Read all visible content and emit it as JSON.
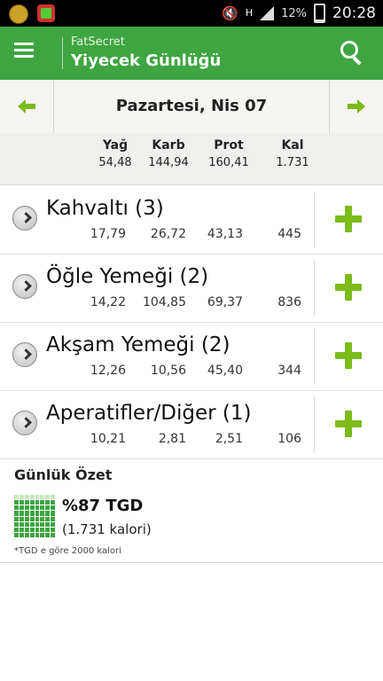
{
  "status_bar": {
    "signal_label": "H",
    "battery_percent": "12%",
    "time": "20:28"
  },
  "app_bar": {
    "subtitle": "FatSecret",
    "title": "Yiyecek Günlüğü"
  },
  "date_nav": {
    "date": "Pazartesi, Nis 07"
  },
  "totals": {
    "headers": [
      "Yağ",
      "Karb",
      "Prot",
      "Kal"
    ],
    "values": [
      "54,48",
      "144,94",
      "160,41",
      "1.731"
    ]
  },
  "meals": [
    {
      "name": "Kahvaltı (3)",
      "values": [
        "17,79",
        "26,72",
        "43,13",
        "445"
      ]
    },
    {
      "name": "Öğle Yemeği (2)",
      "values": [
        "14,22",
        "104,85",
        "69,37",
        "836"
      ]
    },
    {
      "name": "Akşam Yemeği (2)",
      "values": [
        "12,26",
        "10,56",
        "45,40",
        "344"
      ]
    },
    {
      "name": "Aperatifler/Diğer (1)",
      "values": [
        "10,21",
        "2,81",
        "2,51",
        "106"
      ]
    }
  ],
  "summary": {
    "title": "Günlük Özet",
    "percent_label": "%87 TGD",
    "calories_label": "(1.731 kalori)",
    "footnote": "*TGD e göre 2000 kalori",
    "rdi_fraction": 0.87
  },
  "colors": {
    "app_bar": "#3ea540",
    "accent_green": "#7cbb1a"
  },
  "icons": [
    "menu-icon",
    "search-icon",
    "arrow-left-icon",
    "arrow-right-icon",
    "expand-icon",
    "add-icon"
  ]
}
